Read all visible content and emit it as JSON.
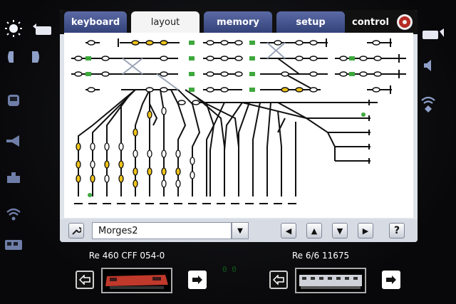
{
  "tabs": {
    "keyboard": "keyboard",
    "layout": "layout",
    "memory": "memory",
    "setup": "setup",
    "control": "control"
  },
  "bottom": {
    "layout_name": "Morges2",
    "help_label": "?"
  },
  "locos": {
    "left_name": "Re 460 CFF 054-0",
    "right_name": "Re 6/6 11675"
  },
  "colors": {
    "tab_blue": "#3d4b86",
    "signal_yellow": "#f0c419",
    "signal_green": "#3ea83e",
    "track": "#111111"
  },
  "icons": {
    "left_side": [
      "light-icon",
      "loco-light-icon",
      "dome-icon",
      "headlight-icon",
      "cabin-icon",
      "horn-icon",
      "coupler-icon",
      "radio-icon",
      "passenger-car-icon"
    ],
    "right_side": [
      "loco-light-icon",
      "speaker-icon",
      "fan-icon"
    ]
  }
}
